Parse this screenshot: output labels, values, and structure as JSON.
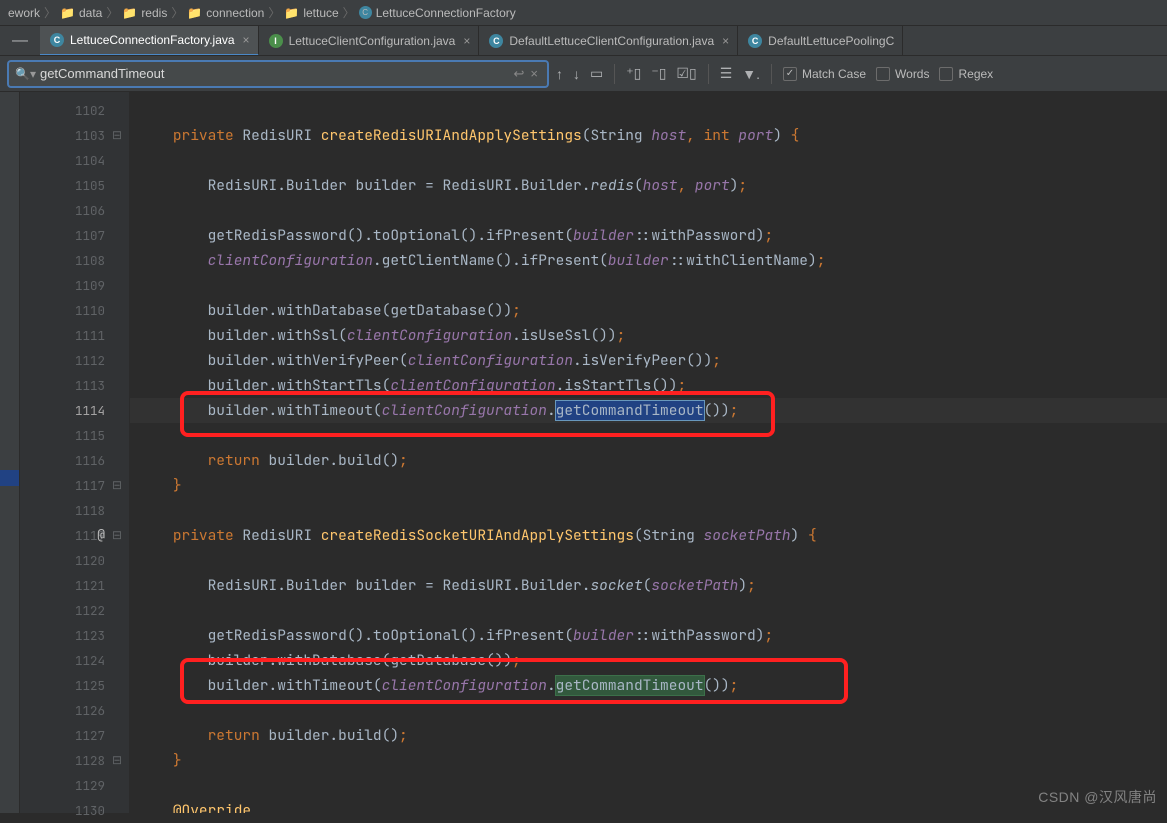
{
  "breadcrumbs": [
    "ework",
    "data",
    "redis",
    "connection",
    "lettuce",
    "LettuceConnectionFactory"
  ],
  "tabs": [
    {
      "name": "LettuceConnectionFactory.java",
      "icon": "blue",
      "active": true
    },
    {
      "name": "LettuceClientConfiguration.java",
      "icon": "green",
      "active": false
    },
    {
      "name": "DefaultLettuceClientConfiguration.java",
      "icon": "blue",
      "active": false
    },
    {
      "name": "DefaultLettucePoolingC",
      "icon": "blue",
      "active": false
    }
  ],
  "search": {
    "query": "getCommandTimeout",
    "match_case": "Match Case",
    "words": "Words",
    "regex": "Regex"
  },
  "gutter": {
    "start": 1102,
    "end": 1130,
    "current": 1114,
    "folds": [
      1103,
      1117,
      1119,
      1128
    ],
    "at": 1119
  },
  "code_lines": [
    "",
    "    private RedisURI createRedisURIAndApplySettings(String host, int port) {",
    "",
    "        RedisURI.Builder builder = RedisURI.Builder.redis(host, port);",
    "",
    "        getRedisPassword().toOptional().ifPresent(builder::withPassword);",
    "        clientConfiguration.getClientName().ifPresent(builder::withClientName);",
    "",
    "        builder.withDatabase(getDatabase());",
    "        builder.withSsl(clientConfiguration.isUseSsl());",
    "        builder.withVerifyPeer(clientConfiguration.isVerifyPeer());",
    "        builder.withStartTls(clientConfiguration.isStartTls());",
    "        builder.withTimeout(clientConfiguration.getCommandTimeout());",
    "",
    "        return builder.build();",
    "    }",
    "",
    "    private RedisURI createRedisSocketURIAndApplySettings(String socketPath) {",
    "",
    "        RedisURI.Builder builder = RedisURI.Builder.socket(socketPath);",
    "",
    "        getRedisPassword().toOptional().ifPresent(builder::withPassword);",
    "        builder.withDatabase(getDatabase());",
    "        builder.withTimeout(clientConfiguration.getCommandTimeout());",
    "",
    "        return builder.build();",
    "    }",
    "",
    "    @Override"
  ],
  "watermark": "CSDN @汉风唐尚"
}
